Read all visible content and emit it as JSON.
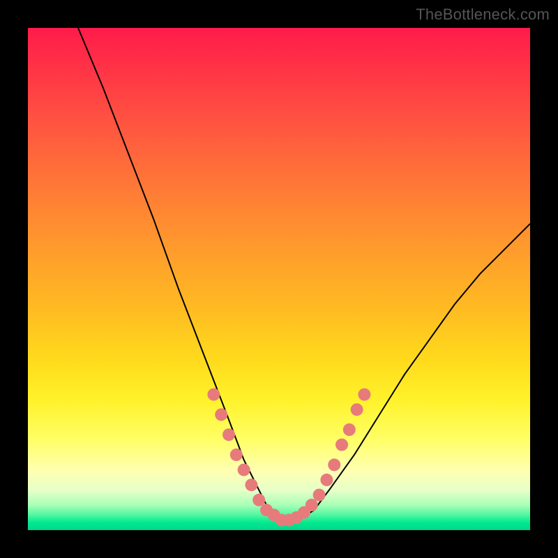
{
  "watermark": "TheBottleneck.com",
  "chart_data": {
    "type": "line",
    "title": "",
    "xlabel": "",
    "ylabel": "",
    "xlim": [
      0,
      100
    ],
    "ylim": [
      0,
      100
    ],
    "series": [
      {
        "name": "curve",
        "x": [
          10,
          15,
          20,
          25,
          30,
          35,
          40,
          43,
          46,
          48,
          50,
          52,
          54,
          57,
          60,
          65,
          70,
          75,
          80,
          85,
          90,
          95,
          100
        ],
        "y": [
          100,
          88,
          75,
          62,
          48,
          35,
          22,
          14,
          8,
          4,
          2,
          1.5,
          2,
          4,
          8,
          15,
          23,
          31,
          38,
          45,
          51,
          56,
          61
        ]
      }
    ],
    "markers": [
      {
        "x": 37,
        "y": 27
      },
      {
        "x": 38.5,
        "y": 23
      },
      {
        "x": 40,
        "y": 19
      },
      {
        "x": 41.5,
        "y": 15
      },
      {
        "x": 43,
        "y": 12
      },
      {
        "x": 44.5,
        "y": 9
      },
      {
        "x": 46,
        "y": 6
      },
      {
        "x": 47.5,
        "y": 4
      },
      {
        "x": 49,
        "y": 3
      },
      {
        "x": 50.5,
        "y": 2
      },
      {
        "x": 52,
        "y": 2
      },
      {
        "x": 53.5,
        "y": 2.5
      },
      {
        "x": 55,
        "y": 3.5
      },
      {
        "x": 56.5,
        "y": 5
      },
      {
        "x": 58,
        "y": 7
      },
      {
        "x": 59.5,
        "y": 10
      },
      {
        "x": 61,
        "y": 13
      },
      {
        "x": 62.5,
        "y": 17
      },
      {
        "x": 64,
        "y": 20
      },
      {
        "x": 65.5,
        "y": 24
      },
      {
        "x": 67,
        "y": 27
      }
    ]
  }
}
